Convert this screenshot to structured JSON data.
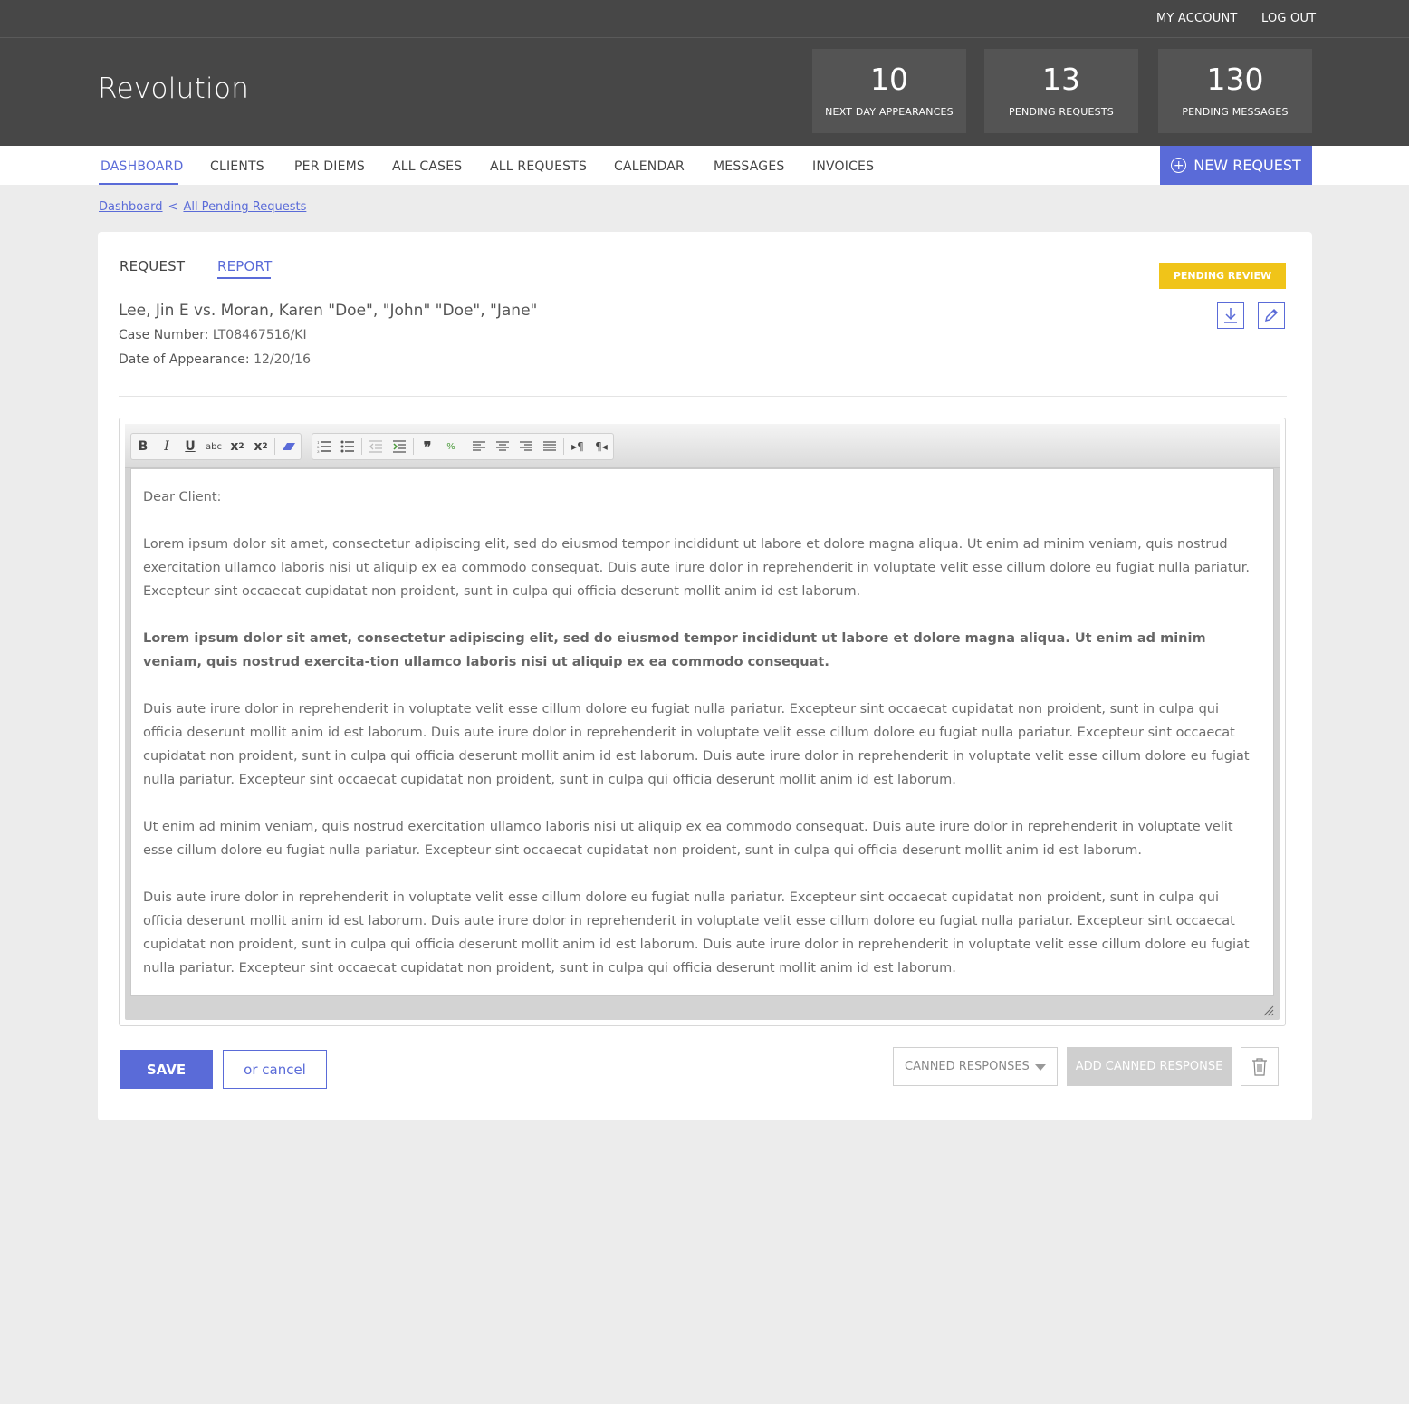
{
  "topbar": {
    "my_account": "MY ACCOUNT",
    "log_out": "LOG OUT"
  },
  "header": {
    "brand": "Revolution",
    "stats": [
      {
        "value": "10",
        "label": "NEXT DAY APPEARANCES"
      },
      {
        "value": "13",
        "label": "PENDING REQUESTS"
      },
      {
        "value": "130",
        "label": "PENDING MESSAGES"
      }
    ]
  },
  "nav": {
    "items": [
      "DASHBOARD",
      "CLIENTS",
      "PER DIEMS",
      "ALL CASES",
      "ALL REQUESTS",
      "CALENDAR",
      "MESSAGES",
      "INVOICES"
    ],
    "active": "DASHBOARD",
    "new_request": "NEW REQUEST"
  },
  "breadcrumb": {
    "home": "Dashboard",
    "separator": "<",
    "current": "All Pending Requests"
  },
  "card": {
    "tabs": [
      "REQUEST",
      "REPORT"
    ],
    "active_tab": "REPORT",
    "status": "PENDING REVIEW",
    "status_color": "#f0c419",
    "case_title": "Lee, Jin E vs. Moran, Karen \"Doe\", \"John\" \"Doe\", \"Jane\"",
    "case_number_label": "Case Number:",
    "case_number": "LT08467516/KI",
    "appearance_label": "Date of Appearance:",
    "appearance_date": "12/20/16"
  },
  "editor": {
    "paragraphs": [
      {
        "text": "Dear Client:",
        "bold": false
      },
      {
        "text": "Lorem ipsum dolor sit amet, consectetur adipiscing elit, sed do eiusmod tempor incididunt ut labore et dolore magna aliqua. Ut enim ad minim veniam, quis nostrud exercitation ullamco laboris nisi ut aliquip ex ea commodo consequat. Duis aute irure dolor in reprehenderit in voluptate velit esse cillum dolore eu fugiat nulla pariatur. Excepteur sint occaecat cupidatat non proident, sunt in culpa qui officia deserunt mollit anim id est laborum.",
        "bold": false
      },
      {
        "text": "Lorem ipsum dolor sit amet, consectetur adipiscing elit, sed do eiusmod tempor incididunt ut labore et dolore magna aliqua. Ut enim ad minim veniam, quis nostrud exercita-tion ullamco laboris nisi ut aliquip ex ea commodo consequat.",
        "bold": true
      },
      {
        "text": "Duis aute irure dolor in reprehenderit in voluptate velit esse cillum dolore eu fugiat nulla pariatur. Excepteur sint occaecat cupidatat non proident, sunt in culpa qui officia deserunt mollit anim id est laborum. Duis aute irure dolor in reprehenderit in voluptate velit esse cillum dolore eu fugiat nulla pariatur. Excepteur sint occaecat cupidatat non proident, sunt in culpa qui officia deserunt mollit anim id est laborum. Duis aute irure dolor in reprehenderit in voluptate velit esse cillum dolore eu fugiat nulla pariatur. Excepteur sint occaecat cupidatat non proident, sunt in culpa qui officia deserunt mollit anim id est laborum.",
        "bold": false
      },
      {
        "text": "Ut enim ad minim veniam, quis nostrud exercitation ullamco laboris nisi ut aliquip ex ea commodo consequat. Duis aute irure dolor in reprehenderit in voluptate velit esse cillum dolore eu fugiat nulla pariatur. Excepteur sint occaecat cupidatat non proident, sunt in culpa qui officia deserunt mollit anim id est laborum.",
        "bold": false
      },
      {
        "text": "Duis aute irure dolor in reprehenderit in voluptate velit esse cillum dolore eu fugiat nulla pariatur. Excepteur sint occaecat cupidatat non proident, sunt in culpa qui officia deserunt mollit anim id est laborum. Duis aute irure dolor in reprehenderit in voluptate velit esse cillum dolore eu fugiat nulla pariatur. Excepteur sint occaecat cupidatat non proident, sunt in culpa qui officia deserunt mollit anim id est laborum. Duis aute irure dolor in reprehenderit in voluptate velit esse cillum dolore eu fugiat nulla pariatur. Excepteur sint occaecat cupidatat non proident, sunt in culpa qui officia deserunt mollit anim id est laborum.",
        "bold": false
      }
    ]
  },
  "actions": {
    "save": "SAVE",
    "cancel": "or cancel",
    "canned_responses": "CANNED RESPONSES",
    "add_canned": "ADD CANNED RESPONSE"
  },
  "colors": {
    "accent": "#5a6bd8",
    "header_bg": "#474747",
    "stat_bg": "#545454"
  }
}
